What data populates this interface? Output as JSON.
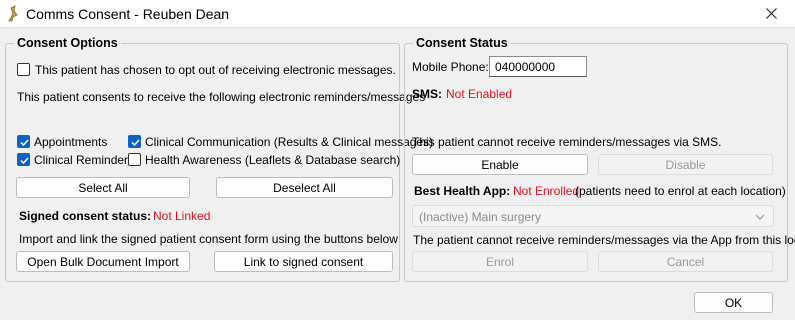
{
  "window": {
    "title": "Comms Consent - Reuben Dean",
    "icon": "app-logo-icon",
    "close_icon": "close-icon"
  },
  "consent_options": {
    "title": "Consent Options",
    "opt_out_label": "This patient has chosen to opt out of receiving electronic messages.",
    "opt_out_checked": false,
    "intro_text": "This patient consents to receive the following electronic reminders/messages",
    "checkboxes": [
      {
        "label": "Appointments",
        "checked": true
      },
      {
        "label": "Clinical Communication (Results & Clinical messages)",
        "checked": true
      },
      {
        "label": "Clinical Reminders",
        "checked": true
      },
      {
        "label": "Health Awareness (Leaflets & Database search)",
        "checked": false
      }
    ],
    "select_all": "Select All",
    "deselect_all": "Deselect All",
    "signed_status_label": "Signed consent status:",
    "signed_status_value": "Not Linked",
    "import_text": "Import and link the signed patient consent form using the buttons below",
    "bulk_import_button": "Open Bulk Document Import",
    "link_button": "Link to signed consent"
  },
  "consent_status": {
    "title": "Consent Status",
    "mobile_label": "Mobile Phone:",
    "mobile_value": "040000000",
    "sms_label": "SMS:",
    "sms_value": "Not Enabled",
    "sms_message": "This patient cannot receive reminders/messages via SMS.",
    "enable_button": "Enable",
    "disable_button": "Disable",
    "bha_label": "Best Health App:",
    "bha_value": "Not Enrolled",
    "bha_note": "(patients need to enrol at each location)",
    "location_select": "(Inactive) Main surgery",
    "app_message": "The patient cannot receive reminders/messages via the App from this location.",
    "enrol_button": "Enrol",
    "cancel_button": "Cancel"
  },
  "ok_button": "OK",
  "colors": {
    "accent": "#0a64c8",
    "status_red": "#e81123"
  }
}
